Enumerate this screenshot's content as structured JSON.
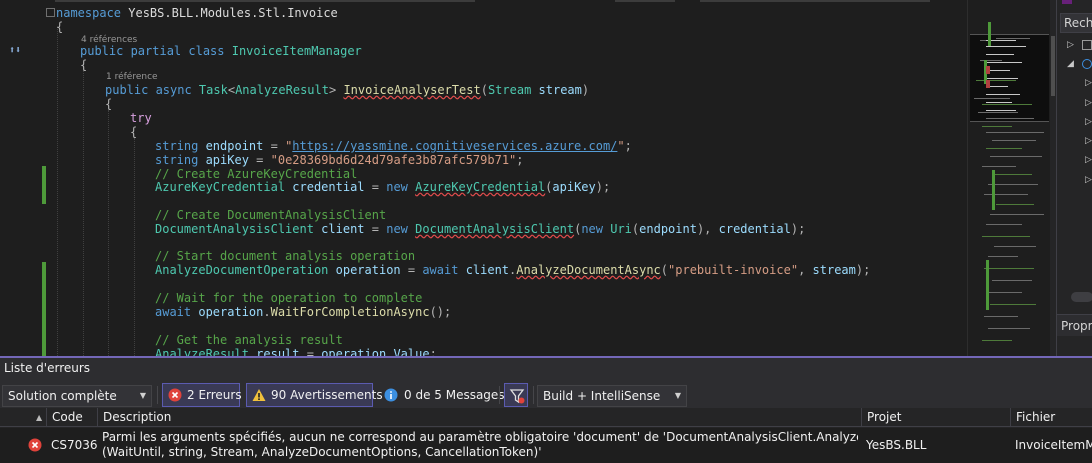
{
  "editor": {
    "lines": [
      [
        [
          "kw",
          "namespace"
        ],
        [
          "id",
          " YesBS.BLL.Modules.Stl.Invoice"
        ]
      ],
      [
        [
          "pn",
          "{"
        ]
      ],
      [
        [
          "kw",
          "public"
        ],
        [
          "kw",
          " partial class "
        ],
        [
          "ty",
          "InvoiceItemManager"
        ]
      ],
      [
        [
          "pn",
          "{"
        ]
      ],
      [
        [
          "kw",
          "public async "
        ],
        [
          "ty",
          "Task"
        ],
        [
          "pn",
          "<"
        ],
        [
          "ty",
          "AnalyzeResult"
        ],
        [
          "pn",
          "> "
        ],
        [
          "fn sq",
          "InvoiceAnalyserTest"
        ],
        [
          "pn",
          "("
        ],
        [
          "ty",
          "Stream"
        ],
        [
          "var",
          " stream"
        ],
        [
          "pn",
          ")"
        ]
      ],
      [
        [
          "pn",
          "{"
        ]
      ],
      [
        [
          "ctl",
          "try"
        ]
      ],
      [
        [
          "pn",
          "{"
        ]
      ],
      [
        [
          "kw",
          "string "
        ],
        [
          "var",
          "endpoint"
        ],
        [
          "pn",
          " = "
        ],
        [
          "str",
          "\""
        ],
        [
          "url",
          "https://yassmine.cognitiveservices.azure.com/"
        ],
        [
          "str",
          "\""
        ],
        [
          "pn",
          ";"
        ]
      ],
      [
        [
          "kw",
          "string "
        ],
        [
          "var",
          "apiKey"
        ],
        [
          "pn",
          " = "
        ],
        [
          "str",
          "\"0e28369bd6d24d79afe3b87afc579b71\""
        ],
        [
          "pn",
          ";"
        ]
      ],
      [
        [
          "cmt",
          "// Create AzureKeyCredential"
        ]
      ],
      [
        [
          "ty",
          "AzureKeyCredential"
        ],
        [
          "var",
          " credential"
        ],
        [
          "pn",
          " = "
        ],
        [
          "kw",
          "new "
        ],
        [
          "ty sq",
          "AzureKeyCredential"
        ],
        [
          "pn",
          "("
        ],
        [
          "var",
          "apiKey"
        ],
        [
          "pn",
          ");"
        ]
      ],
      [
        [
          "cmt",
          "// Create DocumentAnalysisClient"
        ]
      ],
      [
        [
          "ty",
          "DocumentAnalysisClient"
        ],
        [
          "var",
          " client"
        ],
        [
          "pn",
          " = "
        ],
        [
          "kw",
          "new "
        ],
        [
          "ty sq",
          "DocumentAnalysisClient"
        ],
        [
          "pn",
          "("
        ],
        [
          "kw",
          "new "
        ],
        [
          "ty",
          "Uri"
        ],
        [
          "pn",
          "("
        ],
        [
          "var",
          "endpoint"
        ],
        [
          "pn",
          "), "
        ],
        [
          "var",
          "credential"
        ],
        [
          "pn",
          ");"
        ]
      ],
      [
        [
          "cmt",
          "// Start document analysis operation"
        ]
      ],
      [
        [
          "ty",
          "AnalyzeDocumentOperation"
        ],
        [
          "var",
          " operation"
        ],
        [
          "pn",
          " = "
        ],
        [
          "kw",
          "await "
        ],
        [
          "var",
          "client"
        ],
        [
          "pn",
          "."
        ],
        [
          "fn sq",
          "AnalyzeDocumentAsync"
        ],
        [
          "pn",
          "("
        ],
        [
          "str",
          "\"prebuilt-invoice\""
        ],
        [
          "pn",
          ", "
        ],
        [
          "var",
          "stream"
        ],
        [
          "pn",
          ");"
        ]
      ],
      [
        [
          "cmt",
          "// Wait for the operation to complete"
        ]
      ],
      [
        [
          "kw",
          "await "
        ],
        [
          "var",
          "operation"
        ],
        [
          "pn",
          "."
        ],
        [
          "fn",
          "WaitForCompletionAsync"
        ],
        [
          "pn",
          "();"
        ]
      ],
      [
        [
          "cmt",
          "// Get the analysis result"
        ]
      ],
      [
        [
          "ty",
          "AnalyzeResult"
        ],
        [
          "var",
          " result"
        ],
        [
          "pn",
          " = "
        ],
        [
          "var",
          "operation"
        ],
        [
          "pn",
          "."
        ],
        [
          "var",
          "Value"
        ],
        [
          "pn",
          ";"
        ]
      ]
    ],
    "refs_class": "4 références",
    "refs_method": "1 référence"
  },
  "solution_explorer": {
    "search_placeholder": "Recherche",
    "properties_tab": "Propriétés"
  },
  "error_list": {
    "title": "Liste d'erreurs",
    "scope_selected": "Solution complète",
    "errors_label": "2 Erreurs",
    "warnings_label": "90 Avertissements",
    "messages_label": "0 de 5 Messages",
    "build_filter_selected": "Build + IntelliSense",
    "columns": {
      "code": "Code",
      "description": "Description",
      "project": "Projet",
      "file": "Fichier"
    },
    "rows": [
      {
        "code": "CS7036",
        "description_line1": "Parmi les arguments spécifiés, aucun ne correspond au paramètre obligatoire 'document' de 'DocumentAnalysisClient.AnalyzeDocumentAsync",
        "description_line2": "(WaitUntil, string, Stream, AnalyzeDocumentOptions, CancellationToken)'",
        "project": "YesBS.BLL",
        "file": "InvoiceItemManager.cs"
      }
    ]
  },
  "colors": {
    "error": "#e0433b",
    "warning": "#f0c03c",
    "info": "#3c8fe0",
    "accent": "#7367b8",
    "change_bar": "#4e9a3a"
  },
  "icons": {
    "error": "error-circle-icon",
    "warning": "warning-triangle-icon",
    "info": "info-circle-icon",
    "filter": "filter-icon",
    "sort": "sort-icon"
  }
}
